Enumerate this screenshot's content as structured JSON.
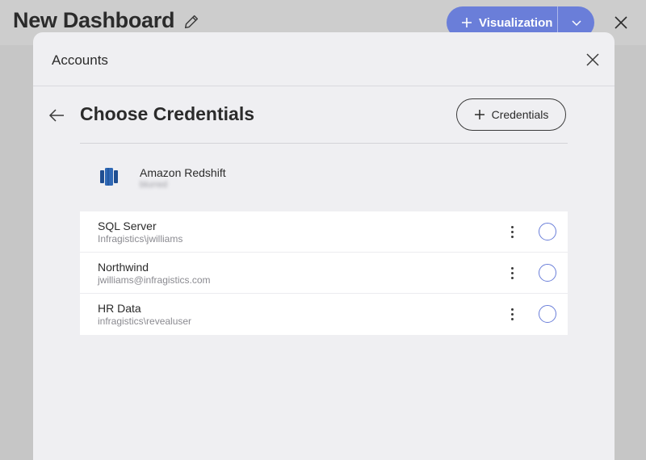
{
  "dashboard": {
    "title": "New Dashboard",
    "visualization_button": "Visualization"
  },
  "modal": {
    "title": "Accounts",
    "section_title": "Choose Credentials",
    "add_credentials_button": "Credentials",
    "datasource": {
      "name": "Amazon Redshift",
      "subtitle": "blurred"
    },
    "credentials": [
      {
        "name": "SQL Server",
        "user": "Infragistics\\jwilliams",
        "selected": false
      },
      {
        "name": "Northwind",
        "user": "jwilliams@infragistics.com",
        "selected": false
      },
      {
        "name": "HR Data",
        "user": "infragistics\\revealuser",
        "selected": false
      }
    ]
  },
  "colors": {
    "accent": "#6a7ed9",
    "backdrop": "#c6c6c6",
    "modal": "#efeff2",
    "redshift_icon": "#2f68b5"
  },
  "icons": [
    "pencil-icon",
    "plus-icon",
    "chevron-down-icon",
    "close-icon",
    "back-arrow-icon",
    "redshift-icon",
    "kebab-menu-icon"
  ]
}
